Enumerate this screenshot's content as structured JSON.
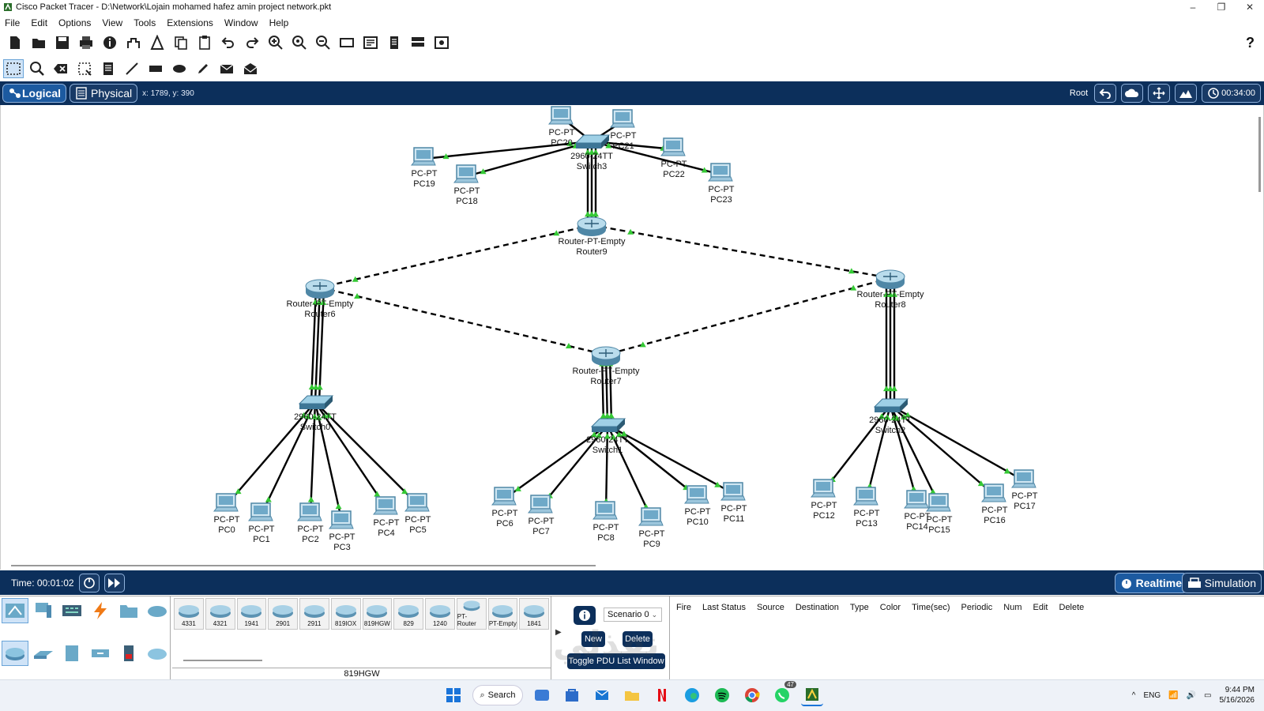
{
  "window": {
    "title": "Cisco Packet Tracer - D:\\Network\\Lojain mohamed hafez amin project network.pkt",
    "controls": [
      "–",
      "❐",
      "✕"
    ]
  },
  "menu": [
    "File",
    "Edit",
    "Options",
    "View",
    "Tools",
    "Extensions",
    "Window",
    "Help"
  ],
  "help_label": "?",
  "viewbar": {
    "logical_label": "Logical",
    "physical_label": "Physical",
    "coords": "x: 1789, y: 390",
    "root_label": "Root",
    "clock": "00:34:00"
  },
  "time": {
    "label": "Time: 00:01:02"
  },
  "modes": {
    "realtime": "Realtime",
    "simulation": "Simulation"
  },
  "devices": [
    "4331",
    "4321",
    "1941",
    "2901",
    "2911",
    "819IOX",
    "819HGW",
    "829",
    "1240",
    "PT-Router",
    "PT-Empty",
    "1841"
  ],
  "device_caption": "819HGW",
  "scenario": {
    "selected": "Scenario 0",
    "new_label": "New",
    "delete_label": "Delete",
    "toggle_label": "Toggle PDU List Window"
  },
  "pdu_columns": [
    "Fire",
    "Last Status",
    "Source",
    "Destination",
    "Type",
    "Color",
    "Time(sec)",
    "Periodic",
    "Num",
    "Edit",
    "Delete"
  ],
  "taskbar": {
    "search_label": "Search",
    "lang": "ENG",
    "time": "9:44 PM",
    "date": "5/16/2026",
    "badge": "47"
  },
  "watermark": "نفذلي",
  "topology": {
    "routers": [
      {
        "id": "r9",
        "type": "Router-PT-Empty",
        "name": "Router9"
      },
      {
        "id": "r6",
        "type": "Router-PT-Empty",
        "name": "Router6"
      },
      {
        "id": "r8",
        "type": "Router-PT-Empty",
        "name": "Router8"
      },
      {
        "id": "r7",
        "type": "Router-PT-Empty",
        "name": "Router7"
      }
    ],
    "switches": [
      {
        "id": "s3",
        "type": "2960-24TT",
        "name": "Switch3"
      },
      {
        "id": "s0",
        "type": "2960-24TT",
        "name": "Switch0"
      },
      {
        "id": "s1",
        "type": "2960-24TT",
        "name": "Switch1"
      },
      {
        "id": "s2",
        "type": "2960-24TT",
        "name": "Switch2"
      }
    ],
    "pcs": [
      {
        "type": "PC-PT",
        "name": "PC20"
      },
      {
        "type": "PC-PT",
        "name": "PC21"
      },
      {
        "type": "PC-PT",
        "name": "PC19"
      },
      {
        "type": "PC-PT",
        "name": "PC18"
      },
      {
        "type": "PC-PT",
        "name": "PC22"
      },
      {
        "type": "PC-PT",
        "name": "PC23"
      },
      {
        "type": "PC-PT",
        "name": "PC0"
      },
      {
        "type": "PC-PT",
        "name": "PC1"
      },
      {
        "type": "PC-PT",
        "name": "PC2"
      },
      {
        "type": "PC-PT",
        "name": "PC3"
      },
      {
        "type": "PC-PT",
        "name": "PC4"
      },
      {
        "type": "PC-PT",
        "name": "PC5"
      },
      {
        "type": "PC-PT",
        "name": "PC6"
      },
      {
        "type": "PC-PT",
        "name": "PC7"
      },
      {
        "type": "PC-PT",
        "name": "PC8"
      },
      {
        "type": "PC-PT",
        "name": "PC9"
      },
      {
        "type": "PC-PT",
        "name": "PC10"
      },
      {
        "type": "PC-PT",
        "name": "PC11"
      },
      {
        "type": "PC-PT",
        "name": "PC12"
      },
      {
        "type": "PC-PT",
        "name": "PC13"
      },
      {
        "type": "PC-PT",
        "name": "PC14"
      },
      {
        "type": "PC-PT",
        "name": "PC15"
      },
      {
        "type": "PC-PT",
        "name": "PC16"
      },
      {
        "type": "PC-PT",
        "name": "PC17"
      }
    ],
    "link_color": "#000000",
    "link_up_color": "#35c935"
  }
}
